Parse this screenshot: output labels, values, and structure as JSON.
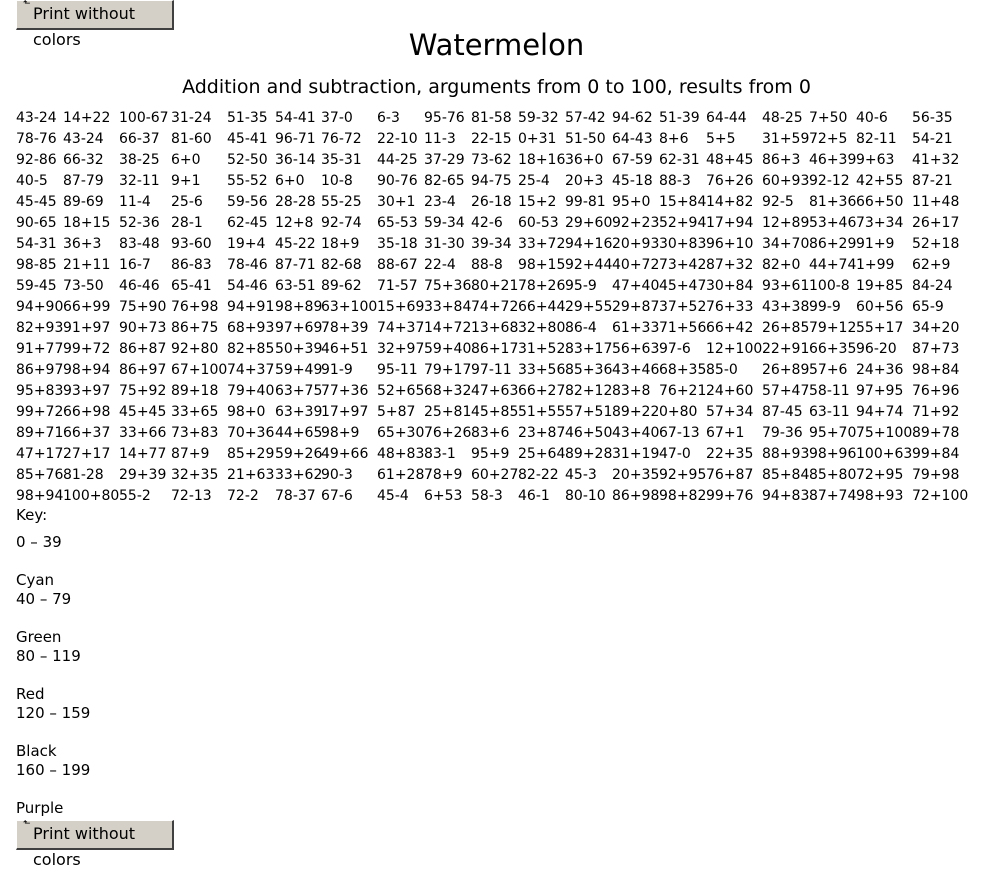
{
  "print_button_label": "Print without colors",
  "title": "Watermelon",
  "subtitle": "Addition and subtraction, arguments from 0 to 100, results from 0",
  "problems": [
    [
      "43-24",
      "14+22",
      "100-67",
      "31-24",
      "51-35",
      "54-41",
      "37-0",
      "6-3",
      "95-76",
      "81-58",
      "59-32",
      "57-42",
      "94-62",
      "51-39",
      "64-44",
      "48-25",
      "7+50",
      "40-6",
      "56-35"
    ],
    [
      "78-76",
      "43-24",
      "66-37",
      "81-60",
      "45-41",
      "96-71",
      "76-72",
      "22-10",
      "11-3",
      "22-15",
      "0+31",
      "51-50",
      "64-43",
      "8+6",
      "5+5",
      "31+59",
      "72+5",
      "82-11",
      "54-21"
    ],
    [
      "92-86",
      "66-32",
      "38-25",
      "6+0",
      "52-50",
      "36-14",
      "35-31",
      "44-25",
      "37-29",
      "73-62",
      "18+16",
      "36+0",
      "67-59",
      "62-31",
      "48+45",
      "86+3",
      "46+39",
      "9+63",
      "41+32"
    ],
    [
      "40-5",
      "87-79",
      "32-11",
      "9+1",
      "55-52",
      "6+0",
      "10-8",
      "90-76",
      "82-65",
      "94-75",
      "25-4",
      "20+3",
      "45-18",
      "88-3",
      "76+26",
      "60+93",
      "92-12",
      "42+55",
      "87-21"
    ],
    [
      "45-45",
      "89-69",
      "11-4",
      "25-6",
      "59-56",
      "28-28",
      "55-25",
      "30+1",
      "23-4",
      "26-18",
      "15+2",
      "99-81",
      "95+0",
      "15+84",
      "14+82",
      "92-5",
      "81+36",
      "66+50",
      "11+48"
    ],
    [
      "90-65",
      "18+15",
      "52-36",
      "28-1",
      "62-45",
      "12+8",
      "92-74",
      "65-53",
      "59-34",
      "42-6",
      "60-53",
      "29+60",
      "92+23",
      "52+94",
      "17+94",
      "12+89",
      "53+46",
      "73+34",
      "26+17"
    ],
    [
      "54-31",
      "36+3",
      "83-48",
      "93-60",
      "19+4",
      "45-22",
      "18+9",
      "35-18",
      "31-30",
      "39-34",
      "33+72",
      "94+16",
      "20+93",
      "30+83",
      "96+10",
      "34+70",
      "86+29",
      "91+9",
      "52+18"
    ],
    [
      "98-85",
      "21+11",
      "16-7",
      "86-83",
      "78-46",
      "87-71",
      "82-68",
      "88-67",
      "22-4",
      "88-8",
      "98+15",
      "92+44",
      "40+72",
      "73+42",
      "87+32",
      "82+0",
      "44+74",
      "1+99",
      "62+9"
    ],
    [
      "59-45",
      "73-50",
      "46-46",
      "65-41",
      "54-46",
      "63-51",
      "89-62",
      "71-57",
      "75+36",
      "80+21",
      "78+26",
      "95-9",
      "47+40",
      "45+47",
      "30+84",
      "93+61",
      "100-8",
      "19+85",
      "84-24"
    ],
    [
      "94+90",
      "66+99",
      "75+90",
      "76+98",
      "94+91",
      "98+89",
      "63+100",
      "15+69",
      "33+84",
      "74+72",
      "66+44",
      "29+55",
      "29+87",
      "37+52",
      "76+33",
      "43+38",
      "99-9",
      "60+56",
      "65-9"
    ],
    [
      "82+93",
      "91+97",
      "90+73",
      "86+75",
      "68+93",
      "97+69",
      "78+39",
      "74+37",
      "14+72",
      "13+68",
      "32+80",
      "86-4",
      "61+33",
      "71+56",
      "66+42",
      "26+85",
      "79+12",
      "55+17",
      "34+20"
    ],
    [
      "91+77",
      "99+72",
      "86+87",
      "92+80",
      "82+85",
      "50+39",
      "46+51",
      "32+97",
      "59+40",
      "86+17",
      "31+52",
      "83+17",
      "56+63",
      "97-6",
      "12+100",
      "22+91",
      "66+35",
      "96-20",
      "87+73"
    ],
    [
      "86+97",
      "98+94",
      "86+97",
      "67+100",
      "74+37",
      "59+49",
      "91-9",
      "95-11",
      "79+17",
      "97-11",
      "33+56",
      "85+36",
      "43+46",
      "68+35",
      "85-0",
      "26+89",
      "57+6",
      "24+36",
      "98+84"
    ],
    [
      "95+83",
      "93+97",
      "75+92",
      "89+18",
      "79+40",
      "63+75",
      "77+36",
      "52+65",
      "68+32",
      "47+63",
      "66+27",
      "82+12",
      "83+8",
      "76+21",
      "24+60",
      "57+47",
      "58-11",
      "97+95",
      "76+96"
    ],
    [
      "99+72",
      "66+98",
      "45+45",
      "33+65",
      "98+0",
      "63+39",
      "17+97",
      "5+87",
      "25+81",
      "45+85",
      "51+55",
      "57+51",
      "89+22",
      "0+80",
      "57+34",
      "87-45",
      "63-11",
      "94+74",
      "71+92"
    ],
    [
      "89+71",
      "66+37",
      "33+66",
      "73+83",
      "70+36",
      "44+65",
      "98+9",
      "65+30",
      "76+26",
      "83+6",
      "23+87",
      "46+50",
      "43+40",
      "67-13",
      "67+1",
      "79-36",
      "95+70",
      "75+100",
      "89+78"
    ],
    [
      "47+17",
      "27+17",
      "14+77",
      "87+9",
      "85+29",
      "59+26",
      "49+66",
      "48+83",
      "83-1",
      "95+9",
      "25+64",
      "89+28",
      "31+19",
      "47-0",
      "22+35",
      "88+93",
      "98+96",
      "100+63",
      "99+84"
    ],
    [
      "85+76",
      "81-28",
      "29+39",
      "32+35",
      "21+63",
      "33+62",
      "90-3",
      "61+28",
      "78+9",
      "60+27",
      "82-22",
      "45-3",
      "20+35",
      "92+95",
      "76+87",
      "85+84",
      "85+80",
      "72+95",
      "79+98"
    ],
    [
      "98+94",
      "100+80",
      "55-2",
      "72-13",
      "72-2",
      "78-37",
      "67-6",
      "45-4",
      "6+53",
      "58-3",
      "46-1",
      "80-10",
      "86+98",
      "98+82",
      "99+76",
      "94+83",
      "87+74",
      "98+93",
      "72+100"
    ]
  ],
  "key_label": "Key:",
  "key_items": [
    {
      "range": "0 – 39",
      "color": "Cyan"
    },
    {
      "range": "40 – 79",
      "color": "Green"
    },
    {
      "range": "80 – 119",
      "color": "Red"
    },
    {
      "range": "120 – 159",
      "color": "Black"
    },
    {
      "range": "160 – 199",
      "color": "Purple"
    }
  ]
}
